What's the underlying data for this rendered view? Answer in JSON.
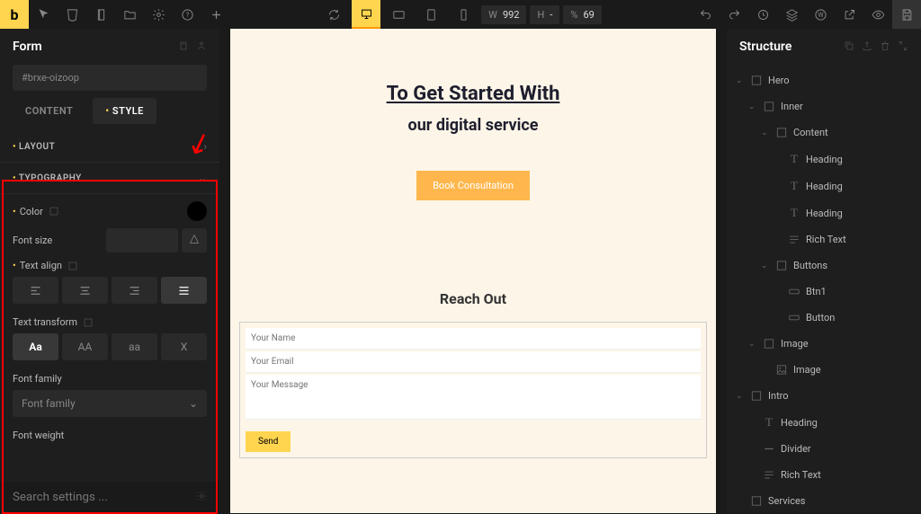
{
  "topbar": {
    "dims": {
      "w_label": "W",
      "w_val": "992",
      "h_label": "H",
      "h_val": "-",
      "pct_label": "%",
      "pct_val": "69"
    }
  },
  "leftPanel": {
    "title": "Form",
    "elementId": "#brxe-oizoop",
    "tabs": {
      "content": "CONTENT",
      "style": "STYLE"
    },
    "sections": {
      "layout": "LAYOUT",
      "typography": "TYPOGRAPHY"
    },
    "props": {
      "color": "Color",
      "fontSize": "Font size",
      "textAlign": "Text align",
      "textTransform": "Text transform",
      "fontFamily": "Font family",
      "fontFamilyPlaceholder": "Font family",
      "fontWeight": "Font weight",
      "transforms": {
        "none": "Aa",
        "upper": "AA",
        "lower": "aa",
        "cap": "X"
      }
    },
    "searchPlaceholder": "Search settings ..."
  },
  "canvas": {
    "heroTitle": "To Get Started With",
    "heroSub": "our digital service",
    "cta": "Book Consultation",
    "formTitle": "Reach Out",
    "fields": {
      "name": "Your Name",
      "email": "Your Email",
      "msg": "Your Message"
    },
    "send": "Send"
  },
  "rightPanel": {
    "title": "Structure",
    "tree": [
      {
        "label": "Hero",
        "icon": "sect",
        "indent": 0,
        "expand": true
      },
      {
        "label": "Inner",
        "icon": "sect",
        "indent": 1,
        "expand": true
      },
      {
        "label": "Content",
        "icon": "sect",
        "indent": 2,
        "expand": true
      },
      {
        "label": "Heading",
        "icon": "text",
        "indent": 3
      },
      {
        "label": "Heading",
        "icon": "text",
        "indent": 3
      },
      {
        "label": "Heading",
        "icon": "text",
        "indent": 3
      },
      {
        "label": "Rich Text",
        "icon": "rich",
        "indent": 3
      },
      {
        "label": "Buttons",
        "icon": "sect",
        "indent": 2,
        "expand": true
      },
      {
        "label": "Btn1",
        "icon": "btn",
        "indent": 3
      },
      {
        "label": "Button",
        "icon": "btn",
        "indent": 3
      },
      {
        "label": "Image",
        "icon": "sect",
        "indent": 1,
        "expand": true
      },
      {
        "label": "Image",
        "icon": "img",
        "indent": 2
      },
      {
        "label": "Intro",
        "icon": "sect",
        "indent": 0,
        "expand": true
      },
      {
        "label": "Heading",
        "icon": "text",
        "indent": 1
      },
      {
        "label": "Divider",
        "icon": "div",
        "indent": 1
      },
      {
        "label": "Rich Text",
        "icon": "rich",
        "indent": 1
      },
      {
        "label": "Services",
        "icon": "sect",
        "indent": 0
      }
    ]
  }
}
